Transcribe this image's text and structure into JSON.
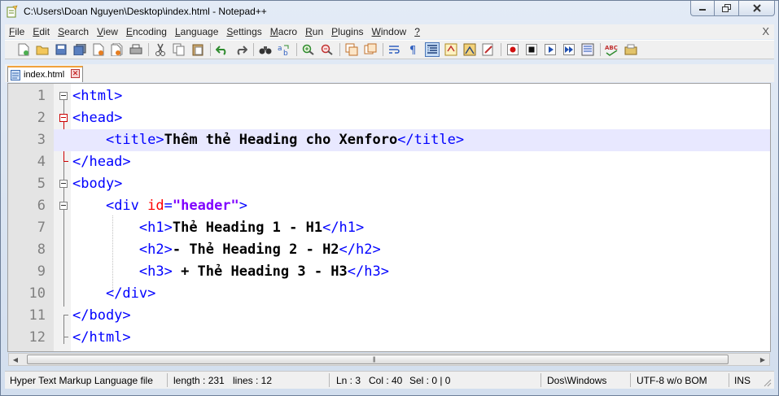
{
  "window": {
    "title": "C:\\Users\\Doan Nguyen\\Desktop\\index.html - Notepad++"
  },
  "menu": {
    "items": [
      {
        "u": "F",
        "rest": "ile"
      },
      {
        "u": "E",
        "rest": "dit"
      },
      {
        "u": "S",
        "rest": "earch"
      },
      {
        "u": "V",
        "rest": "iew"
      },
      {
        "u": "E",
        "rest": "ncoding"
      },
      {
        "u": "L",
        "rest": "anguage"
      },
      {
        "u": "S",
        "rest": "ettings"
      },
      {
        "u": "M",
        "rest": "acro"
      },
      {
        "u": "R",
        "rest": "un"
      },
      {
        "u": "P",
        "rest": "lugins"
      },
      {
        "u": "W",
        "rest": "indow"
      },
      {
        "u": "?",
        "rest": ""
      }
    ],
    "close": "X"
  },
  "tabs": [
    {
      "label": "index.html"
    }
  ],
  "editor": {
    "current_line": 3,
    "lines": [
      {
        "num": "1"
      },
      {
        "num": "2"
      },
      {
        "num": "3"
      },
      {
        "num": "4"
      },
      {
        "num": "5"
      },
      {
        "num": "6"
      },
      {
        "num": "7"
      },
      {
        "num": "8"
      },
      {
        "num": "9"
      },
      {
        "num": "10"
      },
      {
        "num": "11"
      },
      {
        "num": "12"
      }
    ],
    "code": {
      "l1": {
        "tag": "<html>"
      },
      "l2": {
        "tag": "<head>"
      },
      "l3": {
        "open": "<title>",
        "text": "Thêm thẻ Heading cho Xenforo",
        "close": "</title>"
      },
      "l4": {
        "tag": "</head>"
      },
      "l5": {
        "tag": "<body>"
      },
      "l6": {
        "open": "<div",
        "attr": "id",
        "eq": "=",
        "value": "\"header\"",
        "end": ">"
      },
      "l7": {
        "open": "<h1>",
        "text": "Thẻ Heading 1 - H1",
        "close": "</h1>"
      },
      "l8": {
        "open": "<h2>",
        "text": "- Thẻ Heading 2 - H2",
        "close": "</h2>"
      },
      "l9": {
        "open": "<h3>",
        "text": " + Thẻ Heading 3 - H3",
        "close": "</h3>"
      },
      "l10": {
        "tag": "</div>"
      },
      "l11": {
        "tag": "</body>"
      },
      "l12": {
        "tag": "</html>"
      }
    }
  },
  "status": {
    "language": "Hyper Text Markup Language file",
    "length": "length : 231",
    "lines": "lines : 12",
    "ln": "Ln : 3",
    "col": "Col : 40",
    "sel": "Sel : 0 | 0",
    "eol": "Dos\\Windows",
    "encoding": "UTF-8 w/o BOM",
    "mode": "INS"
  }
}
